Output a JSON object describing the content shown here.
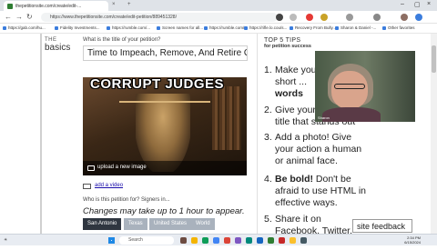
{
  "browser": {
    "tabs": [
      {
        "label": "thepetitionsite.com/create/edit-..."
      }
    ],
    "url": "https://www.thepetitionsite.com/create/edit-petition/889451328/",
    "bookmarks": [
      "https://gab.com/hu...",
      "Fidelity Investments...",
      "https://rumble.com/...",
      "Screen names for all...",
      "https://rumble.com/...",
      "https://rifle.lo.cou/s...",
      "Recovery From Bully...",
      "Sharon & Daniel -...",
      "Other favorites"
    ]
  },
  "section": {
    "kicker": "THE",
    "heading": "basics"
  },
  "petition": {
    "title_question": "What is the title of your petition?",
    "title_value": "Time to Impeach, Remove, And Retire O",
    "image_headline": "CORRUPT JUDGES",
    "upload_label": "upload a new image",
    "video_label": "add a video",
    "target_question": "Who is this petition for? Signers in...",
    "warning": "Changes may take up to 1 hour to appear.",
    "targets": [
      "San Antonio",
      "Texas",
      "United States",
      "World"
    ]
  },
  "tips": {
    "heading": "TOP 5 TIPS",
    "subheading": "for petition success",
    "items": [
      {
        "num": "1.",
        "pre": "Make your title",
        "line2": "short ...",
        "bold": "words",
        "post": ""
      },
      {
        "num": "2.",
        "pre": "Give your petition a",
        "line2": "title that stands out",
        "bold": "",
        "post": ""
      },
      {
        "num": "3.",
        "pre": "Add a photo! Give your action a human or animal face.",
        "line2": "",
        "bold": "",
        "post": ""
      },
      {
        "num": "4.",
        "pre": "",
        "line2": "",
        "bold": "Be bold!",
        "post": " Don't be afraid to use HTML in effective ways."
      },
      {
        "num": "5.",
        "pre": "Share it on Facebook, Twitter, and via email...",
        "line2": "",
        "bold": "",
        "post": ""
      }
    ]
  },
  "webcam": {
    "name": "Sharon"
  },
  "feedback_label": "site feedback",
  "taskbar": {
    "search_placeholder": "Search",
    "time": "2:34 PM",
    "date": "6/15/2024"
  },
  "colors": {
    "chip_selected": "#2f3640",
    "chip_default": "#a9b2bd",
    "link": "#1a0dab"
  }
}
